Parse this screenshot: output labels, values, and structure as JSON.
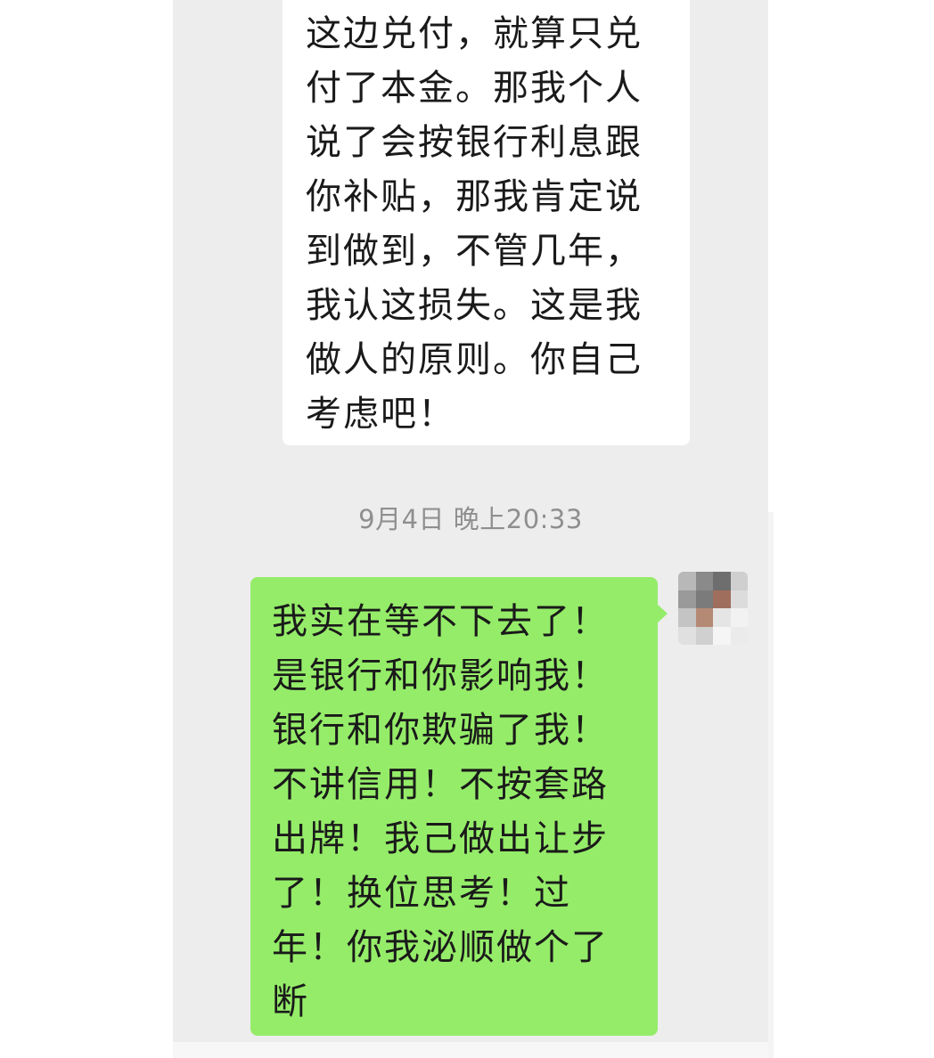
{
  "messages": {
    "incoming_text": "这边兑付，就算只兑\n付了本金。那我个人\n说了会按银行利息跟\n你补贴，那我肯定说\n到做到，不管几年，\n我认这损失。这是我\n做人的原则。你自己\n考虑吧！",
    "timestamp": "9月4日 晚上20:33",
    "outgoing_text": "我实在等不下去了！\n是银行和你影响我！\n银行和你欺骗了我！\n不讲信用！不按套路\n出牌！我己做出让步\n了！换位思考！过\n年！你我泌顺做个了\n断"
  },
  "colors": {
    "chat_background": "#ededed",
    "incoming_bubble": "#ffffff",
    "outgoing_bubble": "#95ec69",
    "timestamp_text": "#8f8f8f"
  },
  "avatar": {
    "icon": "pixelated-avatar-icon"
  }
}
